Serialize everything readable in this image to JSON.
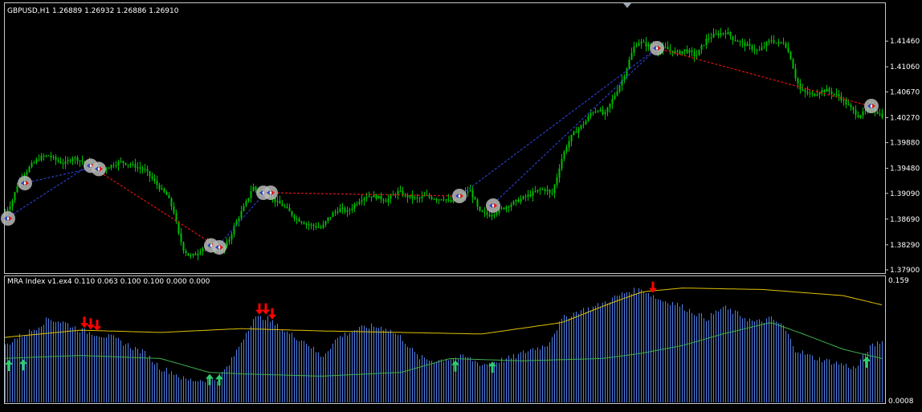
{
  "colors": {
    "background": "#000000",
    "frame": "#c8c8c8",
    "bull_candle": "#00c000",
    "bear_candle": "#00c000",
    "trend_up": "#2a3fc8",
    "trend_down": "#e01010",
    "signal_marker": "#b8b8b8",
    "histogram": "#4f7fe8",
    "upper_band": "#e0c000",
    "lower_band": "#3fb04f",
    "buy_arrow": "#2ecc71",
    "sell_arrow": "#ff0000",
    "text": "#ffffff"
  },
  "price_panel": {
    "title": "GBPUSD,H1  1.26889 1.26932 1.26886 1.26910",
    "y_ticks": [
      "1.41460",
      "1.41060",
      "1.40670",
      "1.40270",
      "1.39880",
      "1.39480",
      "1.39090",
      "1.38690",
      "1.38290",
      "1.37900"
    ]
  },
  "indicator_panel": {
    "title": "MRA Index v1.ex4 0.110 0.063 0.100 0.100 0.000 0.000",
    "y_top_label": "0.159",
    "y_bottom_label": "0.0008"
  },
  "chart_data": [
    {
      "type": "candlestick",
      "symbol": "GBPUSD",
      "timeframe": "H1",
      "last_ohlc": [
        1.26889,
        1.26932,
        1.26886,
        1.2691
      ],
      "ylim": [
        1.379,
        1.4175
      ],
      "price_path": [
        [
          0,
          1.3875
        ],
        [
          6,
          1.388
        ],
        [
          14,
          1.3895
        ],
        [
          22,
          1.3925
        ],
        [
          30,
          1.394
        ],
        [
          40,
          1.3955
        ],
        [
          50,
          1.3965
        ],
        [
          60,
          1.3968
        ],
        [
          70,
          1.396
        ],
        [
          80,
          1.3955
        ],
        [
          90,
          1.3965
        ],
        [
          100,
          1.396
        ],
        [
          110,
          1.3955
        ],
        [
          118,
          1.395
        ],
        [
          126,
          1.3945
        ],
        [
          134,
          1.395
        ],
        [
          142,
          1.3955
        ],
        [
          150,
          1.3958
        ],
        [
          160,
          1.3955
        ],
        [
          170,
          1.395
        ],
        [
          180,
          1.3945
        ],
        [
          190,
          1.393
        ],
        [
          200,
          1.3915
        ],
        [
          208,
          1.3905
        ],
        [
          216,
          1.388
        ],
        [
          222,
          1.3845
        ],
        [
          228,
          1.3822
        ],
        [
          236,
          1.381
        ],
        [
          244,
          1.3815
        ],
        [
          252,
          1.3825
        ],
        [
          260,
          1.383
        ],
        [
          268,
          1.3823
        ],
        [
          276,
          1.382
        ],
        [
          284,
          1.3835
        ],
        [
          292,
          1.386
        ],
        [
          300,
          1.388
        ],
        [
          308,
          1.39
        ],
        [
          314,
          1.392
        ],
        [
          320,
          1.3912
        ],
        [
          328,
          1.391
        ],
        [
          336,
          1.3905
        ],
        [
          344,
          1.3895
        ],
        [
          352,
          1.389
        ],
        [
          360,
          1.388
        ],
        [
          368,
          1.387
        ],
        [
          376,
          1.3865
        ],
        [
          384,
          1.386
        ],
        [
          392,
          1.3858
        ],
        [
          400,
          1.3855
        ],
        [
          408,
          1.387
        ],
        [
          416,
          1.388
        ],
        [
          424,
          1.3885
        ],
        [
          432,
          1.388
        ],
        [
          440,
          1.389
        ],
        [
          448,
          1.39
        ],
        [
          456,
          1.3905
        ],
        [
          464,
          1.3905
        ],
        [
          472,
          1.3902
        ],
        [
          480,
          1.3898
        ],
        [
          488,
          1.3905
        ],
        [
          496,
          1.3912
        ],
        [
          504,
          1.3905
        ],
        [
          512,
          1.3903
        ],
        [
          520,
          1.39
        ],
        [
          528,
          1.3905
        ],
        [
          536,
          1.3903
        ],
        [
          544,
          1.39
        ],
        [
          552,
          1.3902
        ],
        [
          560,
          1.3895
        ],
        [
          568,
          1.39
        ],
        [
          576,
          1.3905
        ],
        [
          584,
          1.3915
        ],
        [
          590,
          1.39
        ],
        [
          596,
          1.388
        ],
        [
          602,
          1.3878
        ],
        [
          608,
          1.3875
        ],
        [
          616,
          1.388
        ],
        [
          624,
          1.3885
        ],
        [
          632,
          1.389
        ],
        [
          640,
          1.3895
        ],
        [
          648,
          1.39
        ],
        [
          656,
          1.3905
        ],
        [
          664,
          1.391
        ],
        [
          672,
          1.3915
        ],
        [
          680,
          1.3915
        ],
        [
          686,
          1.3905
        ],
        [
          692,
          1.393
        ],
        [
          698,
          1.396
        ],
        [
          704,
          1.398
        ],
        [
          712,
          1.4
        ],
        [
          720,
          1.401
        ],
        [
          728,
          1.402
        ],
        [
          736,
          1.4035
        ],
        [
          744,
          1.404
        ],
        [
          752,
          1.403
        ],
        [
          760,
          1.405
        ],
        [
          768,
          1.407
        ],
        [
          776,
          1.409
        ],
        [
          784,
          1.412
        ],
        [
          790,
          1.414
        ],
        [
          796,
          1.4145
        ],
        [
          804,
          1.414
        ],
        [
          812,
          1.4138
        ],
        [
          820,
          1.4132
        ],
        [
          828,
          1.4135
        ],
        [
          836,
          1.413
        ],
        [
          844,
          1.4128
        ],
        [
          852,
          1.4132
        ],
        [
          860,
          1.4128
        ],
        [
          866,
          1.4122
        ],
        [
          872,
          1.4135
        ],
        [
          880,
          1.415
        ],
        [
          888,
          1.4155
        ],
        [
          896,
          1.4158
        ],
        [
          904,
          1.416
        ],
        [
          912,
          1.415
        ],
        [
          920,
          1.4145
        ],
        [
          928,
          1.414
        ],
        [
          936,
          1.4135
        ],
        [
          944,
          1.413
        ],
        [
          952,
          1.414
        ],
        [
          960,
          1.4148
        ],
        [
          968,
          1.4142
        ],
        [
          976,
          1.4145
        ],
        [
          984,
          1.412
        ],
        [
          990,
          1.409
        ],
        [
          996,
          1.407
        ],
        [
          1004,
          1.4065
        ],
        [
          1012,
          1.4062
        ],
        [
          1020,
          1.4068
        ],
        [
          1028,
          1.407
        ],
        [
          1036,
          1.4065
        ],
        [
          1044,
          1.406
        ],
        [
          1052,
          1.405
        ],
        [
          1060,
          1.404
        ],
        [
          1068,
          1.403
        ],
        [
          1076,
          1.4035
        ],
        [
          1084,
          1.4045
        ],
        [
          1092,
          1.4035
        ],
        [
          1098,
          1.403
        ]
      ],
      "trend_lines": [
        {
          "x1": 8,
          "y1": 1.387,
          "x2": 110,
          "y2": 1.3952,
          "kind": "up"
        },
        {
          "x1": 30,
          "y1": 1.3925,
          "x2": 120,
          "y2": 1.395,
          "kind": "up"
        },
        {
          "x1": 112,
          "y1": 1.3952,
          "x2": 265,
          "y2": 1.383,
          "kind": "down"
        },
        {
          "x1": 270,
          "y1": 1.3825,
          "x2": 330,
          "y2": 1.391,
          "kind": "up"
        },
        {
          "x1": 335,
          "y1": 1.391,
          "x2": 572,
          "y2": 1.3905,
          "kind": "down"
        },
        {
          "x1": 572,
          "y1": 1.3905,
          "x2": 818,
          "y2": 1.4135,
          "kind": "up"
        },
        {
          "x1": 612,
          "y1": 1.389,
          "x2": 818,
          "y2": 1.4135,
          "kind": "up"
        },
        {
          "x1": 818,
          "y1": 1.4135,
          "x2": 1083,
          "y2": 1.4045,
          "kind": "down"
        }
      ],
      "signal_markers": [
        {
          "x": 10,
          "y": 1.387
        },
        {
          "x": 31,
          "y": 1.3925
        },
        {
          "x": 113,
          "y": 1.3952
        },
        {
          "x": 123,
          "y": 1.3947
        },
        {
          "x": 263,
          "y": 1.3828
        },
        {
          "x": 273,
          "y": 1.3825
        },
        {
          "x": 328,
          "y": 1.391
        },
        {
          "x": 337,
          "y": 1.391
        },
        {
          "x": 572,
          "y": 1.3905
        },
        {
          "x": 614,
          "y": 1.389
        },
        {
          "x": 818,
          "y": 1.4135
        },
        {
          "x": 1085,
          "y": 1.4045
        }
      ]
    },
    {
      "type": "histogram",
      "name": "MRA Index",
      "ylim": [
        0.0008,
        0.159
      ],
      "hist_path": [
        [
          0,
          0.07
        ],
        [
          20,
          0.085
        ],
        [
          40,
          0.095
        ],
        [
          60,
          0.11
        ],
        [
          80,
          0.105
        ],
        [
          100,
          0.095
        ],
        [
          120,
          0.09
        ],
        [
          140,
          0.085
        ],
        [
          160,
          0.075
        ],
        [
          180,
          0.065
        ],
        [
          200,
          0.045
        ],
        [
          215,
          0.04
        ],
        [
          230,
          0.03
        ],
        [
          250,
          0.03
        ],
        [
          270,
          0.032
        ],
        [
          285,
          0.05
        ],
        [
          300,
          0.08
        ],
        [
          315,
          0.11
        ],
        [
          330,
          0.112
        ],
        [
          345,
          0.1
        ],
        [
          360,
          0.09
        ],
        [
          380,
          0.08
        ],
        [
          400,
          0.06
        ],
        [
          420,
          0.085
        ],
        [
          440,
          0.095
        ],
        [
          460,
          0.1
        ],
        [
          480,
          0.098
        ],
        [
          500,
          0.085
        ],
        [
          520,
          0.06
        ],
        [
          540,
          0.055
        ],
        [
          560,
          0.058
        ],
        [
          580,
          0.06
        ],
        [
          600,
          0.05
        ],
        [
          620,
          0.055
        ],
        [
          640,
          0.06
        ],
        [
          660,
          0.07
        ],
        [
          680,
          0.075
        ],
        [
          700,
          0.11
        ],
        [
          720,
          0.12
        ],
        [
          740,
          0.125
        ],
        [
          760,
          0.135
        ],
        [
          780,
          0.145
        ],
        [
          800,
          0.148
        ],
        [
          820,
          0.135
        ],
        [
          840,
          0.13
        ],
        [
          860,
          0.12
        ],
        [
          880,
          0.11
        ],
        [
          900,
          0.125
        ],
        [
          920,
          0.115
        ],
        [
          940,
          0.105
        ],
        [
          960,
          0.11
        ],
        [
          975,
          0.1
        ],
        [
          990,
          0.07
        ],
        [
          1010,
          0.06
        ],
        [
          1030,
          0.055
        ],
        [
          1050,
          0.05
        ],
        [
          1065,
          0.045
        ],
        [
          1080,
          0.07
        ],
        [
          1095,
          0.08
        ]
      ],
      "upper_band": [
        [
          0,
          0.085
        ],
        [
          100,
          0.095
        ],
        [
          200,
          0.092
        ],
        [
          300,
          0.097
        ],
        [
          400,
          0.094
        ],
        [
          500,
          0.092
        ],
        [
          600,
          0.09
        ],
        [
          700,
          0.105
        ],
        [
          760,
          0.13
        ],
        [
          800,
          0.145
        ],
        [
          850,
          0.15
        ],
        [
          950,
          0.148
        ],
        [
          1050,
          0.14
        ],
        [
          1098,
          0.128
        ]
      ],
      "lower_band": [
        [
          0,
          0.058
        ],
        [
          100,
          0.062
        ],
        [
          200,
          0.058
        ],
        [
          260,
          0.04
        ],
        [
          300,
          0.038
        ],
        [
          400,
          0.035
        ],
        [
          500,
          0.04
        ],
        [
          560,
          0.058
        ],
        [
          650,
          0.055
        ],
        [
          750,
          0.058
        ],
        [
          800,
          0.065
        ],
        [
          850,
          0.075
        ],
        [
          900,
          0.09
        ],
        [
          960,
          0.105
        ],
        [
          1000,
          0.09
        ],
        [
          1050,
          0.07
        ],
        [
          1098,
          0.058
        ]
      ],
      "sell_arrows": [
        105,
        113,
        121,
        323,
        331,
        339,
        813
      ],
      "buy_arrows": [
        11,
        29,
        261,
        273,
        567,
        613,
        1079
      ]
    }
  ]
}
